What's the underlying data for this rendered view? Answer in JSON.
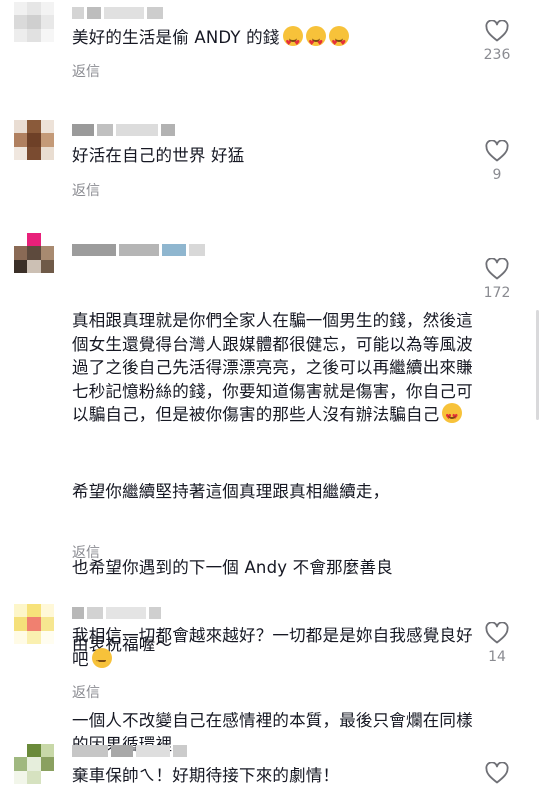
{
  "reply_label": "返信",
  "comments": [
    {
      "text": "美好的生活是偷 ANDY 的錢",
      "emoji": [
        "face-with-hearts-emoji",
        "face-with-hearts-emoji",
        "face-with-hearts-emoji"
      ],
      "likes": "236"
    },
    {
      "text": "好活在自己的世界 好猛",
      "likes": "9"
    },
    {
      "paragraphs": [
        "真相跟真理就是你們全家人在騙一個男生的錢，然後這個女生還覺得台灣人跟媒體都很健忘，可能以為等風波過了之後自己先活得漂漂亮亮，之後可以再繼續出來賺七秒記憶粉絲的錢，你要知道傷害就是傷害，你自己可以騙自己，但是被你傷害的那些人沒有辦法騙自己",
        "希望你繼續堅持著這個真理跟真相繼續走，",
        "也希望你遇到的下一個 Andy 不會那麼善良",
        "由衷祝福喔～",
        "一個人不改變自己在感情裡的本質，最後只會爛在同樣的因果循環裡。"
      ],
      "emoji": [
        "heart-eyes-emoji"
      ],
      "likes": "172"
    },
    {
      "text": "我相信一切都會越來越好？一切都是是妳自我感覺良好吧",
      "emoji": [
        "expressionless-face-emoji"
      ],
      "likes": "14"
    },
    {
      "text": "棄車保帥ㄟ！好期待接下來的劇情！"
    }
  ],
  "colors": {
    "text": "#161823",
    "secondary": "#8a8b91",
    "emoji_face": "#f7c23a"
  },
  "icons": {
    "like": "heart-outline-icon"
  }
}
